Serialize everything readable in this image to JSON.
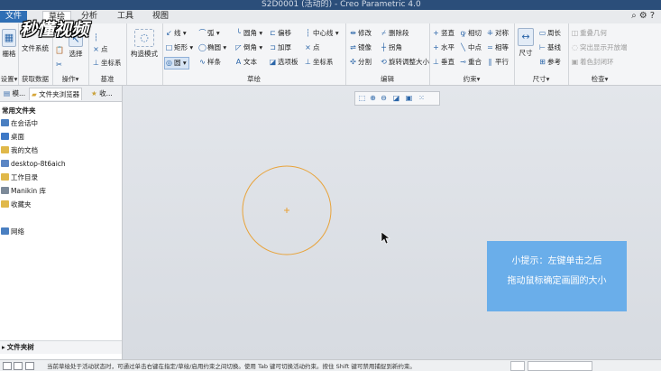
{
  "window": {
    "title": "S2D0001 (活动的) - Creo Parametric 4.0"
  },
  "tabs": [
    {
      "label": "文件"
    },
    {
      "label": "草绘"
    },
    {
      "label": "分析"
    },
    {
      "label": "工具"
    },
    {
      "label": "视图"
    }
  ],
  "ribbon": {
    "setup": {
      "grid": "栅格",
      "label": "设置▾"
    },
    "data": {
      "filesys": "文件系统",
      "label": "获取数据"
    },
    "ops": {
      "select": "选择",
      "label": "操作▾"
    },
    "datum": {
      "point": "点",
      "coord": "坐标系",
      "label": "基准"
    },
    "construct": {
      "label": "构造模式"
    },
    "sketch": {
      "line": "线",
      "arc": "弧",
      "fillet": "圆角",
      "offset": "偏移",
      "centerline": "中心线",
      "rect": "矩形",
      "ellipse": "椭圆",
      "chamfer": "倒角",
      "thicken": "加厚",
      "point": "点",
      "circle": "圆",
      "spline": "样条",
      "text": "文本",
      "palette": "选项板",
      "coord": "坐标系",
      "label": "草绘"
    },
    "edit": {
      "modify": "修改",
      "delete_seg": "删除段",
      "mirror": "镜像",
      "corner": "拐角",
      "divide": "分割",
      "rotate_resize": "旋转调整大小",
      "label": "编辑"
    },
    "constrain": {
      "vertical": "竖直",
      "tangent": "相切",
      "symmetric": "对称",
      "horizontal": "水平",
      "midpoint": "中点",
      "equal": "相等",
      "perpendicular": "垂直",
      "coincident": "重合",
      "parallel": "平行",
      "label": "约束▾"
    },
    "dimension": {
      "dim": "尺寸",
      "perimeter": "周长",
      "baseline": "基线",
      "reference": "参考",
      "label": "尺寸▾"
    },
    "inspect": {
      "overlap": "重叠几何",
      "highlight_open": "突出显示开放端",
      "shade_closed": "着色封闭环",
      "label": "检查▾"
    }
  },
  "logo": {
    "text": "秒懂视频"
  },
  "panel": {
    "tabs": [
      "模...",
      "文件夹浏览器",
      "收..."
    ],
    "common_folders": "常用文件夹",
    "items": [
      {
        "label": "在会话中",
        "color": "#4a7fc1"
      },
      {
        "label": "桌面",
        "color": "#3e79c6"
      },
      {
        "label": "我的文档",
        "color": "#e0b84a"
      },
      {
        "label": "desktop-8t6aich",
        "color": "#5b86c4"
      },
      {
        "label": "工作目录",
        "color": "#e0b84a"
      },
      {
        "label": "Manikin 库",
        "color": "#7d8a99"
      },
      {
        "label": "收藏夹",
        "color": "#e0b84a"
      },
      {
        "label": "网络",
        "color": "#4a7fc1"
      }
    ],
    "folder_tree": "文件夹树"
  },
  "tip": {
    "line1": "小提示：左键单击之后",
    "line2": "拖动鼠标确定画圆的大小"
  },
  "sketch_circle": {
    "color": "#e8a33a"
  },
  "status": {
    "message": "当前草绘处于活动状态时，可通过单击右键在指定/草绘/启用约束之间切换。使用 Tab 键可切换活动约束。按住 Shift 键可禁用捕捉到新约束。"
  }
}
